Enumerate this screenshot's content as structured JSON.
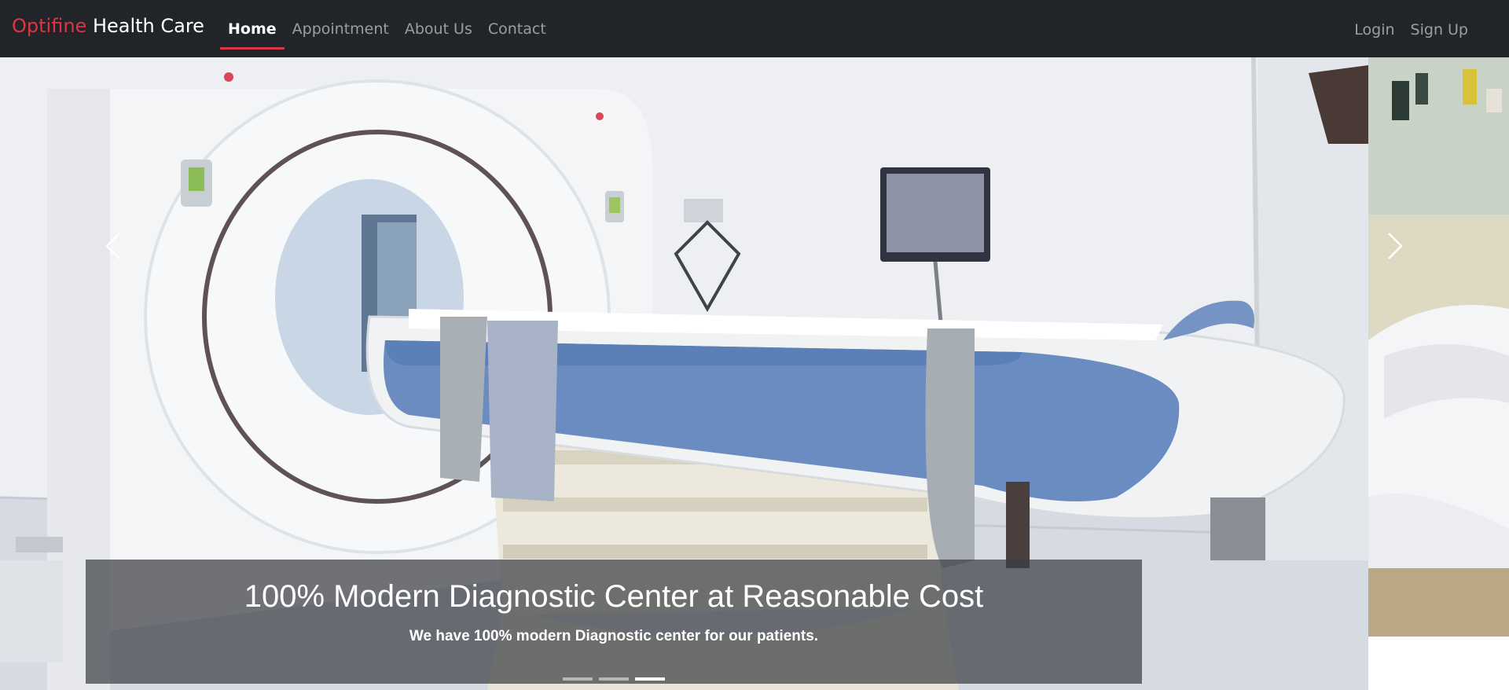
{
  "brand": {
    "accent": "Optifine",
    "rest": "Health Care"
  },
  "nav": {
    "left": [
      {
        "label": "Home",
        "active": true
      },
      {
        "label": "Appointment",
        "active": false
      },
      {
        "label": "About Us",
        "active": false
      },
      {
        "label": "Contact",
        "active": false
      }
    ],
    "right": [
      {
        "label": "Login"
      },
      {
        "label": "Sign Up"
      }
    ]
  },
  "carousel": {
    "caption_title": "100% Modern Diagnostic Center at Reasonable Cost",
    "caption_text": "We have 100% modern Diagnostic center for our patients.",
    "slide_count": 3,
    "active_slide": 3,
    "controls": {
      "prev_icon": "chevron-left-icon",
      "next_icon": "chevron-right-icon"
    }
  },
  "colors": {
    "navbar_bg": "#212529",
    "brand_accent": "#dc3545",
    "nav_inactive": "#8b8e91",
    "nav_active": "#ffffff"
  }
}
